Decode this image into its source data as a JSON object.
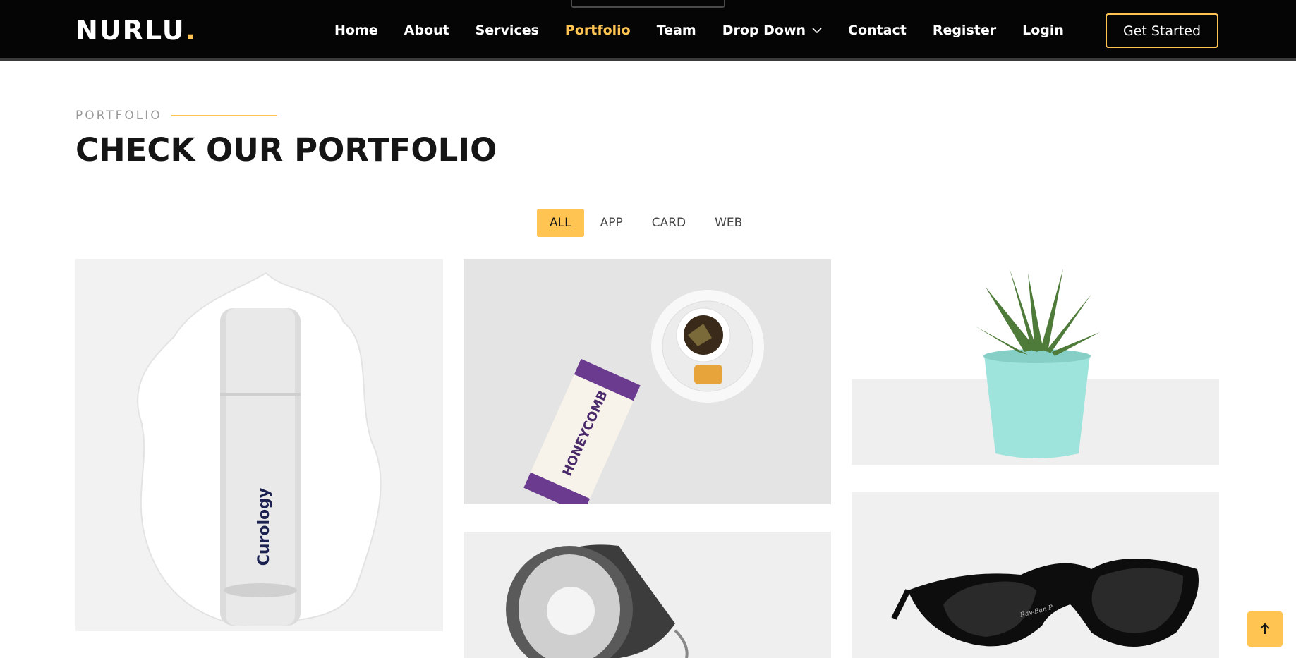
{
  "brand": {
    "name": "NURLU",
    "dot": "."
  },
  "nav": {
    "items": [
      {
        "label": "Home"
      },
      {
        "label": "About"
      },
      {
        "label": "Services"
      },
      {
        "label": "Portfolio",
        "active": true
      },
      {
        "label": "Team"
      },
      {
        "label": "Drop Down",
        "has_dropdown": true
      },
      {
        "label": "Contact"
      },
      {
        "label": "Register"
      },
      {
        "label": "Login"
      }
    ],
    "cta_label": "Get Started"
  },
  "section": {
    "label": "PORTFOLIO",
    "title": "CHECK OUR PORTFOLIO"
  },
  "filters": [
    {
      "label": "ALL",
      "active": true
    },
    {
      "label": "APP"
    },
    {
      "label": "CARD"
    },
    {
      "label": "WEB"
    }
  ],
  "gallery": {
    "items": [
      {
        "subject": "skincare bottle",
        "brand_text": "Curology"
      },
      {
        "subject": "honeycomb tea tin and cup",
        "brand_text": "HONEYCOMB"
      },
      {
        "subject": "succulent in mint pot"
      },
      {
        "subject": "desk lamp"
      },
      {
        "subject": "black sunglasses",
        "brand_text": "Ray-Ban P"
      }
    ]
  },
  "colors": {
    "accent": "#ffc451",
    "header_bg": "#050505",
    "title": "#151515"
  },
  "icons": {
    "dropdown": "chevron-down-icon",
    "scroll_top": "arrow-up-icon"
  }
}
